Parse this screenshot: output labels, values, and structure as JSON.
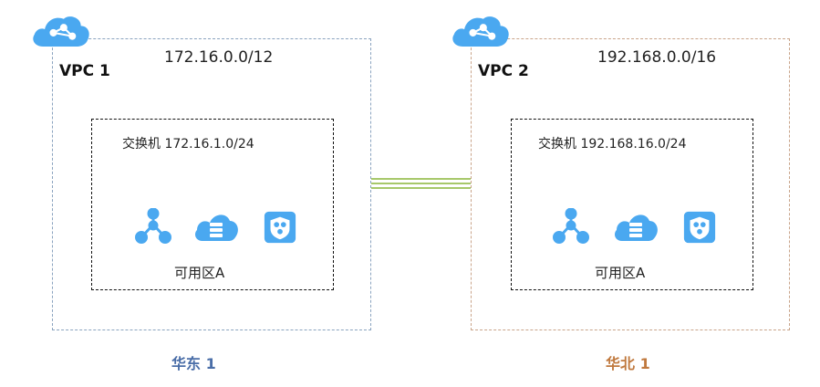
{
  "colors": {
    "icon_blue": "#4aa8f0",
    "left_border": "#8aa3bf",
    "right_border": "#c9a48a",
    "left_region": "#4a6ea8",
    "right_region": "#c0793e",
    "link_green": "#a7c86a"
  },
  "left": {
    "vpc_label": "VPC 1",
    "cidr": "172.16.0.0/12",
    "switch_label": "交换机 172.16.1.0/24",
    "zone_label": "可用区A",
    "region_label": "华东 1",
    "icons": [
      "network-node-icon",
      "cloud-server-icon",
      "security-group-icon"
    ]
  },
  "right": {
    "vpc_label": "VPC 2",
    "cidr": "192.168.0.0/16",
    "switch_label": "交换机 192.168.16.0/24",
    "zone_label": "可用区A",
    "region_label": "华北 1",
    "icons": [
      "network-node-icon",
      "cloud-server-icon",
      "security-group-icon"
    ]
  }
}
